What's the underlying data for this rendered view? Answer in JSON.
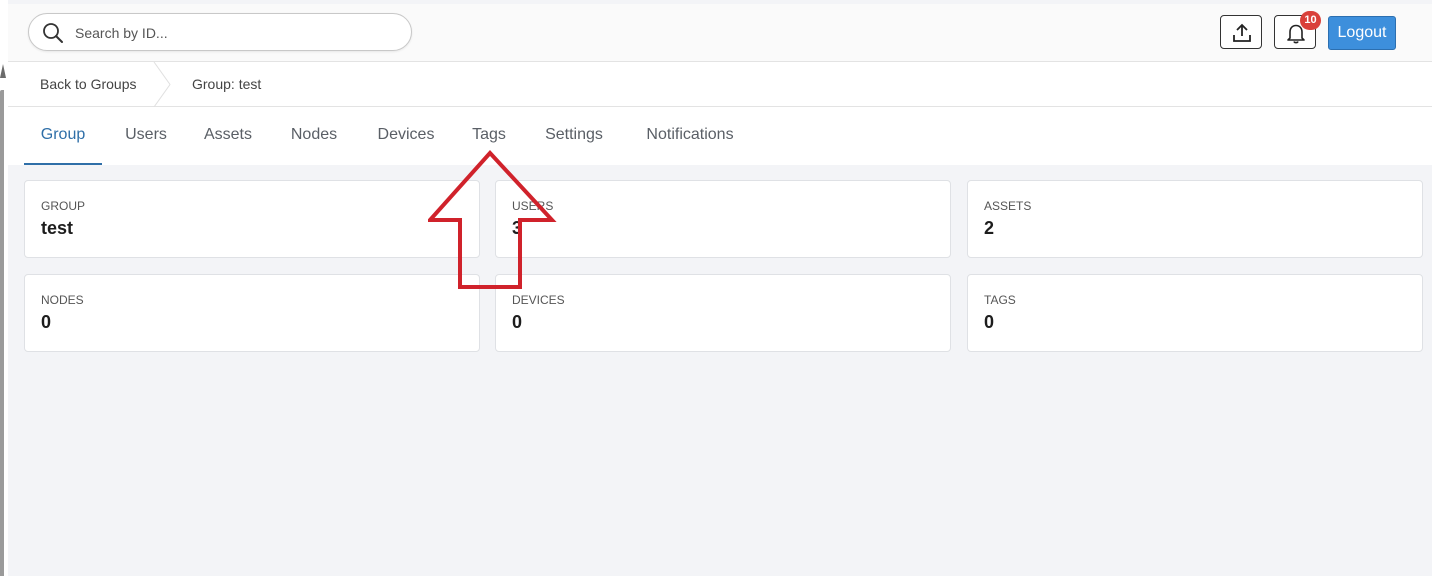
{
  "search": {
    "placeholder": "Search by ID..."
  },
  "header": {
    "notification_count": "10",
    "logout_label": "Logout"
  },
  "breadcrumb": {
    "items": [
      "Back to Groups",
      "Group: test"
    ]
  },
  "tabs": [
    "Group",
    "Users",
    "Assets",
    "Nodes",
    "Devices",
    "Tags",
    "Settings",
    "Notifications"
  ],
  "active_tab": "Group",
  "cards": [
    {
      "label": "GROUP",
      "value": "test"
    },
    {
      "label": "USERS",
      "value": "3"
    },
    {
      "label": "ASSETS",
      "value": "2"
    },
    {
      "label": "NODES",
      "value": "0"
    },
    {
      "label": "DEVICES",
      "value": "0"
    },
    {
      "label": "TAGS",
      "value": "0"
    }
  ],
  "colors": {
    "accent": "#2f6fa8",
    "logout": "#3d8fdc",
    "badge": "#d9403a",
    "annotation_arrow": "#d0222b"
  },
  "icons": {
    "search": "search-icon",
    "upload": "upload-icon",
    "bell": "bell-icon",
    "annotation": "up-arrow-annotation"
  }
}
